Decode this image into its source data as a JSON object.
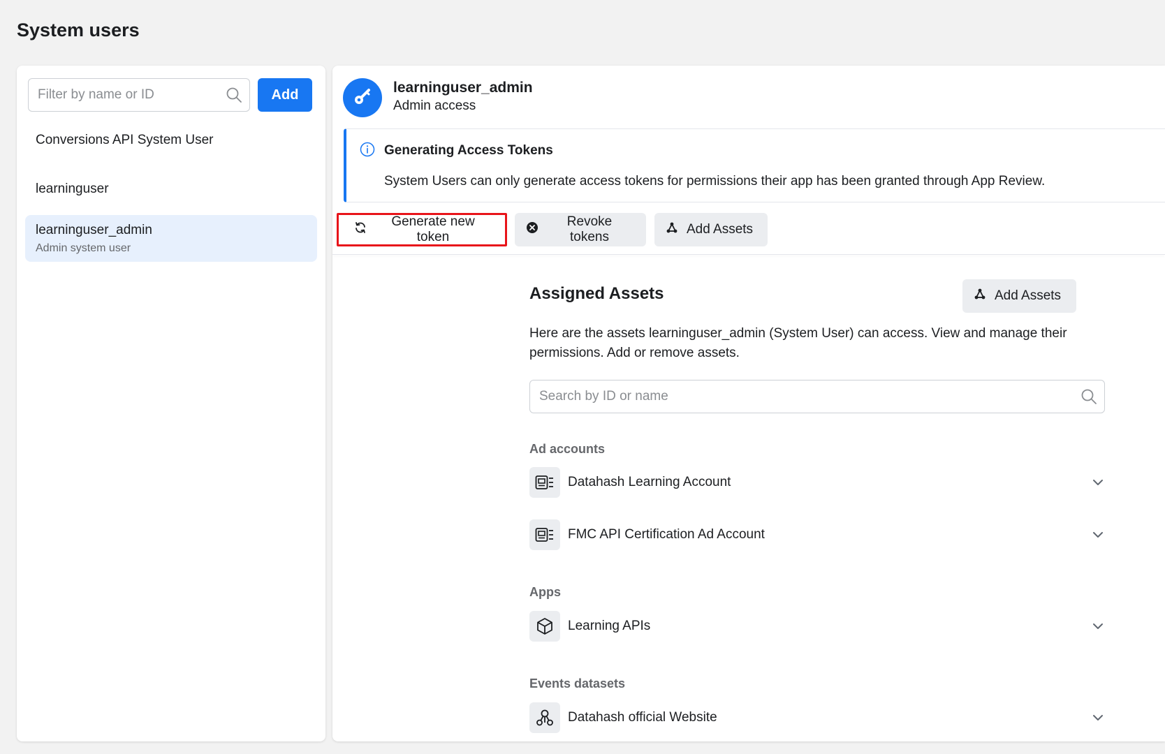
{
  "page": {
    "title": "System users"
  },
  "left": {
    "filter_placeholder": "Filter by name or ID",
    "add_label": "Add",
    "users": [
      {
        "name": "Conversions API System User",
        "sub": ""
      },
      {
        "name": "learninguser",
        "sub": ""
      },
      {
        "name": "learninguser_admin",
        "sub": "Admin system user",
        "selected": true
      }
    ]
  },
  "detail": {
    "user_name": "learninguser_admin",
    "access": "Admin access",
    "notice": {
      "title": "Generating Access Tokens",
      "body": "System Users can only generate access tokens for permissions their app has been granted through App Review."
    },
    "actions": {
      "generate": "Generate new token",
      "revoke": "Revoke tokens",
      "add_assets": "Add Assets"
    }
  },
  "assets": {
    "title": "Assigned Assets",
    "add_label": "Add Assets",
    "description": "Here are the assets learninguser_admin (System User) can access. View and manage their permissions. Add or remove assets.",
    "search_placeholder": "Search by ID or name",
    "sections": [
      {
        "heading": "Ad accounts",
        "items": [
          "Datahash Learning Account",
          "FMC API Certification Ad Account"
        ],
        "icon": "ad-account-icon"
      },
      {
        "heading": "Apps",
        "items": [
          "Learning APIs"
        ],
        "icon": "app-cube-icon"
      },
      {
        "heading": "Events datasets",
        "items": [
          "Datahash official Website"
        ],
        "icon": "dataset-icon"
      }
    ]
  },
  "colors": {
    "accent": "#1877f2",
    "highlight_border": "#e8141a",
    "selected_bg": "#e7f0fd"
  }
}
